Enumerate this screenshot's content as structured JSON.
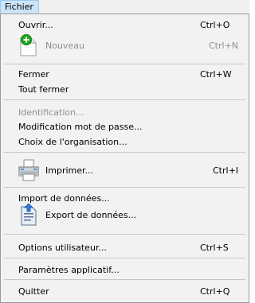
{
  "menubar": {
    "title": "Fichier"
  },
  "menu": {
    "items": [
      {
        "label": "Ouvrir...",
        "shortcut": "Ctrl+O"
      },
      {
        "label": "Nouveau",
        "shortcut": "Ctrl+N",
        "icon": "new-document-icon",
        "disabled": true
      },
      {
        "label": "Fermer",
        "shortcut": "Ctrl+W"
      },
      {
        "label": "Tout fermer"
      },
      {
        "label": "Identification...",
        "disabled": true
      },
      {
        "label": "Modification mot de passe..."
      },
      {
        "label": "Choix de l'organisation..."
      },
      {
        "label": "Imprimer...",
        "shortcut": "Ctrl+I",
        "icon": "printer-icon"
      },
      {
        "label": "Import de données..."
      },
      {
        "label": "Export de données...",
        "icon": "export-icon"
      },
      {
        "label": "Options utilisateur...",
        "shortcut": "Ctrl+S"
      },
      {
        "label": "Paramètres applicatif..."
      },
      {
        "label": "Quitter",
        "shortcut": "Ctrl+Q"
      }
    ]
  },
  "colors": {
    "menu_bg": "#f2f2f2",
    "highlight": "#cce4f7",
    "disabled_text": "#8e8e8e",
    "new_icon_green": "#1ea81e"
  }
}
